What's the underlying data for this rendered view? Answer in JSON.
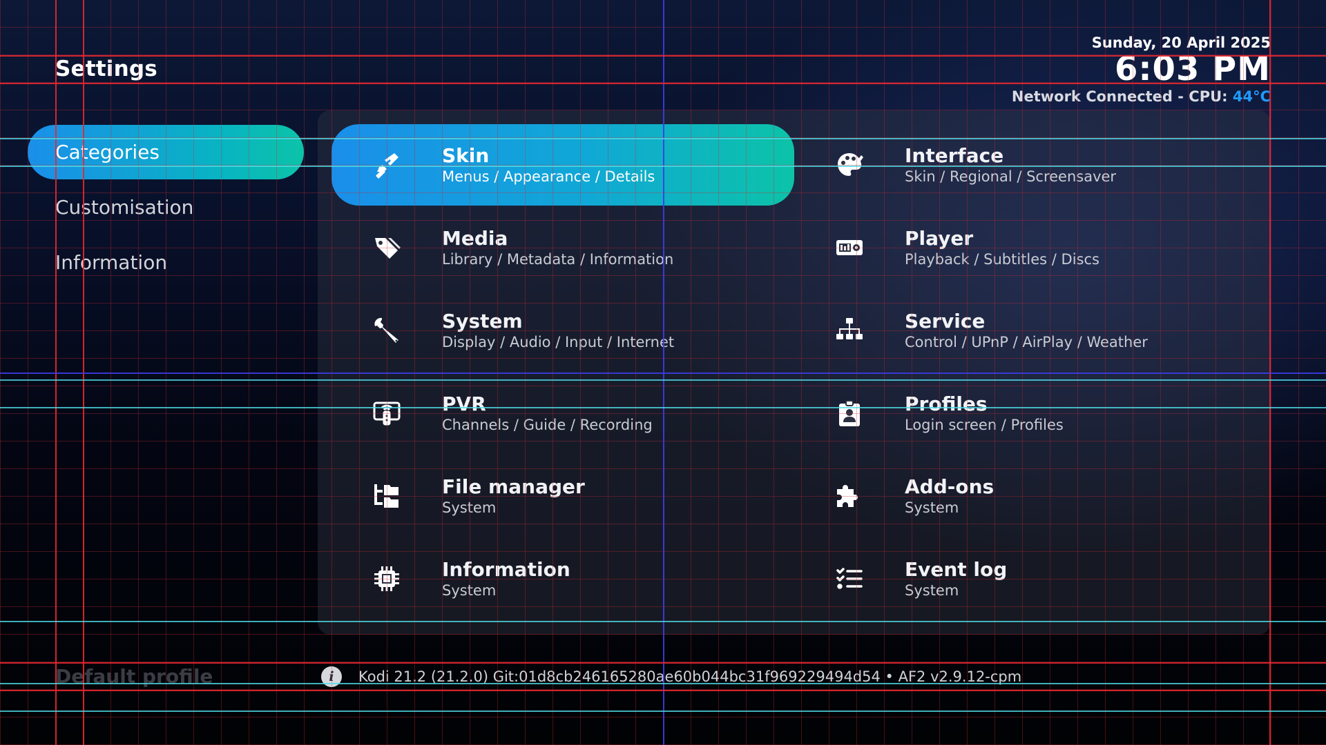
{
  "header": {
    "title": "Settings",
    "date": "Sunday, 20 April 2025",
    "time": "6:03 PM",
    "status_prefix": "Network Connected - CPU: ",
    "cpu_temp": "44°C"
  },
  "sidebar": {
    "items": [
      {
        "label": "Categories",
        "active": true
      },
      {
        "label": "Customisation"
      },
      {
        "label": "Information"
      }
    ]
  },
  "tiles": [
    {
      "title": "Skin",
      "subtitle": "Menus / Appearance / Details",
      "icon": "paintbrush-icon",
      "active": true
    },
    {
      "title": "Interface",
      "subtitle": "Skin / Regional / Screensaver",
      "icon": "palette-icon"
    },
    {
      "title": "Media",
      "subtitle": "Library / Metadata / Information",
      "icon": "tags-icon"
    },
    {
      "title": "Player",
      "subtitle": "Playback / Subtitles / Discs",
      "icon": "player-icon"
    },
    {
      "title": "System",
      "subtitle": "Display / Audio / Input / Internet",
      "icon": "wrench-icon"
    },
    {
      "title": "Service",
      "subtitle": "Control / UPnP / AirPlay / Weather",
      "icon": "network-icon"
    },
    {
      "title": "PVR",
      "subtitle": "Channels / Guide / Recording",
      "icon": "tv-icon"
    },
    {
      "title": "Profiles",
      "subtitle": "Login screen / Profiles",
      "icon": "id-badge-icon"
    },
    {
      "title": "File manager",
      "subtitle": "System",
      "icon": "folder-tree-icon"
    },
    {
      "title": "Add-ons",
      "subtitle": "System",
      "icon": "puzzle-icon"
    },
    {
      "title": "Information",
      "subtitle": "System",
      "icon": "chip-icon"
    },
    {
      "title": "Event log",
      "subtitle": "System",
      "icon": "list-check-icon"
    }
  ],
  "footer": {
    "profile": "Default profile",
    "info_icon": "info-icon",
    "version": "Kodi 21.2 (21.2.0) Git:01d8cb246165280ae60b044bc31f969229494d54 • AF2 v2.9.12-cpm"
  },
  "colors": {
    "accent_start": "#1a8fea",
    "accent_end": "#0cc3a8",
    "cpu_temp": "#1f9bff"
  }
}
